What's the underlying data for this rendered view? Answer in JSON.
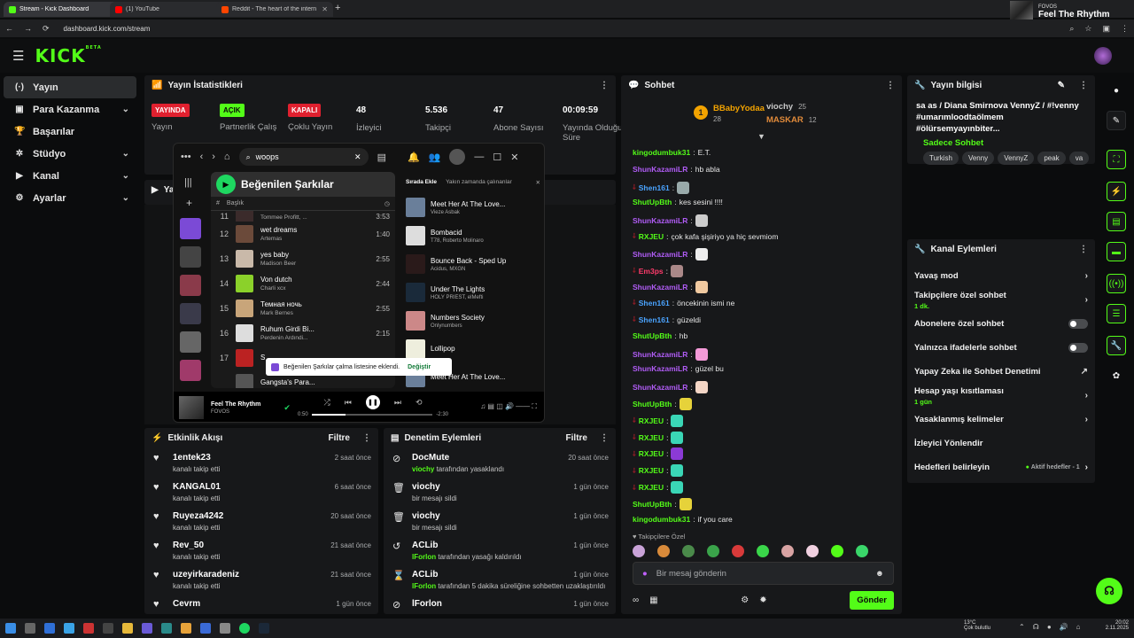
{
  "browser": {
    "tabs": [
      {
        "label": "Stream - Kick Dashboard",
        "color": "#53fc18"
      },
      {
        "label": "(1) YouTube",
        "color": "#ff0000"
      },
      {
        "label": "Reddit - The heart of the intern",
        "color": "#ff4500"
      }
    ],
    "url": "dashboard.kick.com/stream",
    "profile": {
      "channel": "FOVOS",
      "title": "Feel The Rhythm"
    }
  },
  "kick": {
    "logo": "KICK",
    "beta": "BETA"
  },
  "sidebar": {
    "items": [
      {
        "label": "Yayın",
        "icon": "broadcast-icon",
        "selected": true,
        "chevron": false
      },
      {
        "label": "Para Kazanma",
        "icon": "wallet-icon",
        "selected": false,
        "chevron": true
      },
      {
        "label": "Başarılar",
        "icon": "trophy-icon",
        "selected": false,
        "chevron": false
      },
      {
        "label": "Stüdyo",
        "icon": "gear-icon",
        "selected": false,
        "chevron": true
      },
      {
        "label": "Kanal",
        "icon": "play-icon",
        "selected": false,
        "chevron": true
      },
      {
        "label": "Ayarlar",
        "icon": "settings-icon",
        "selected": false,
        "chevron": true
      }
    ]
  },
  "stats": {
    "title": "Yayın İstatistikleri",
    "items": [
      {
        "badge": "YAYINDA",
        "label": "Yayın"
      },
      {
        "badge": "AÇIK",
        "label": "Partnerlik Çalış"
      },
      {
        "badge": "KAPALI",
        "label": "Çoklu Yayın"
      },
      {
        "value": "48",
        "label": "İzleyici"
      },
      {
        "value": "5.536",
        "label": "Takipçi"
      },
      {
        "value": "47",
        "label": "Abone Sayısı"
      },
      {
        "value": "00:09:59",
        "label": "Yayında Olduğu Süre"
      }
    ]
  },
  "spotify": {
    "search": "woops",
    "playlist": "Beğenilen Şarkılar",
    "header_title": "Başlık",
    "tracks": [
      {
        "n": "11",
        "title": "",
        "artist": "Tommee Profitt, ...",
        "dur": "3:53",
        "color": "#3b2b2b"
      },
      {
        "n": "12",
        "title": "wet dreams",
        "artist": "Artemas",
        "dur": "1:40",
        "color": "#6b4a3a"
      },
      {
        "n": "13",
        "title": "yes baby",
        "artist": "Madison Beer",
        "dur": "2:55",
        "color": "#c9b9a9"
      },
      {
        "n": "14",
        "title": "Von dutch",
        "artist": "Charli xcx",
        "dur": "2:44",
        "color": "#8bd12a"
      },
      {
        "n": "15",
        "title": "Темная ночь",
        "artist": "Mark Bernes",
        "dur": "2:55",
        "color": "#c8a57a"
      },
      {
        "n": "16",
        "title": "Ruhum Girdi Bi...",
        "artist": "Perdenin Ardındi...",
        "dur": "2:15",
        "color": "#ddd"
      },
      {
        "n": "17",
        "title": "S",
        "artist": "",
        "dur": "",
        "color": "#b22"
      },
      {
        "n": "",
        "title": "Gangsta's Para...",
        "artist": "",
        "dur": "",
        "color": "#555"
      }
    ],
    "queue_tabs": [
      "Sırada Ekle",
      "Yakın zamanda çalınanlar"
    ],
    "queue": [
      {
        "title": "Meet Her At The Love...",
        "artist": "Vieze Asbak",
        "color": "#6a7f9a"
      },
      {
        "title": "Bombacid",
        "artist": "T78, Roberto Molinaro",
        "color": "#ddd"
      },
      {
        "title": "Bounce Back - Sped Up",
        "artist": "Acidus, MXGN",
        "color": "#2a1a1a"
      },
      {
        "title": "Under The Lights",
        "artist": "HOLY PRIEST, elMefti",
        "color": "#1a2a3a"
      },
      {
        "title": "Numbers Society",
        "artist": "Onlynumbers",
        "color": "#c88"
      },
      {
        "title": "Lollipop",
        "artist": "",
        "color": "#eed"
      },
      {
        "title": "Meet Her At The Love...",
        "artist": "",
        "color": "#6a7f9a"
      }
    ],
    "toast": "Beğenilen Şarkılar çalma listesine eklendi.",
    "toast_action": "Değiştir",
    "now_playing": {
      "title": "Feel The Rhythm",
      "artist": "FOVOS",
      "elapsed": "0:50",
      "remaining": "-2:30",
      "progress": 0.28
    }
  },
  "activity": {
    "title": "Etkinlik Akışı",
    "filter": "Filtre",
    "events": [
      {
        "name": "1entek23",
        "desc": "kanalı takip etti",
        "time": "2 saat önce"
      },
      {
        "name": "KANGAL01",
        "desc": "kanalı takip etti",
        "time": "6 saat önce"
      },
      {
        "name": "Ruyeza4242",
        "desc": "kanalı takip etti",
        "time": "20 saat önce"
      },
      {
        "name": "Rev_50",
        "desc": "kanalı takip etti",
        "time": "21 saat önce"
      },
      {
        "name": "uzeyirkaradeniz",
        "desc": "kanalı takip etti",
        "time": "21 saat önce"
      },
      {
        "name": "Cevrm",
        "desc": "",
        "time": "1 gün önce"
      }
    ]
  },
  "moderation": {
    "title": "Denetim Eylemleri",
    "filter": "Filtre",
    "events": [
      {
        "name": "DocMute",
        "actor": "viochy",
        "desc": "tarafından yasaklandı",
        "time": "20 saat önce",
        "icon": "ban-icon"
      },
      {
        "name": "viochy",
        "actor": "",
        "desc": "bir mesajı sildi",
        "time": "1 gün önce",
        "icon": "trash-icon"
      },
      {
        "name": "viochy",
        "actor": "",
        "desc": "bir mesajı sildi",
        "time": "1 gün önce",
        "icon": "trash-icon"
      },
      {
        "name": "ACLib",
        "actor": "lForlon",
        "desc": "tarafından yasağı kaldırıldı",
        "time": "1 gün önce",
        "icon": "undo-icon"
      },
      {
        "name": "ACLib",
        "actor": "lForlon",
        "desc": "tarafından 5 dakika süreliğine sohbetten uzaklaştırıldı",
        "time": "1 gün önce",
        "icon": "hourglass-icon"
      },
      {
        "name": "lForlon",
        "actor": "",
        "desc": "",
        "time": "1 gün önce",
        "icon": "ban-icon"
      }
    ]
  },
  "chat": {
    "title": "Sohbet",
    "pinned": [
      {
        "name": "BBabyYodaa",
        "count": "28",
        "color": "#f3a300"
      },
      {
        "name": "viochy",
        "count": "25",
        "color": "#c9c9c9"
      },
      {
        "name": "MASKAR",
        "count": "12",
        "color": "#e08a3a"
      }
    ],
    "messages": [
      {
        "user": "kingodumbuk31",
        "color": "#53fc18",
        "text": "E.T.",
        "badge": false,
        "emote": ""
      },
      {
        "user": "ShunKazamiLR",
        "color": "#b05cf5",
        "text": "hb abla",
        "badge": false,
        "emote": ""
      },
      {
        "user": "Shen161",
        "color": "#4aa3ff",
        "text": "",
        "badge": true,
        "emote": "#9aa"
      },
      {
        "user": "ShutUpBth",
        "color": "#53fc18",
        "text": "kes sesini !!!!",
        "badge": false,
        "emote": ""
      },
      {
        "user": "ShunKazamiLR",
        "color": "#b05cf5",
        "text": "",
        "badge": false,
        "emote": "#ccc"
      },
      {
        "user": "RXJEU",
        "color": "#53fc18",
        "text": "çok kafa şişiriyo ya hiç sevmiom",
        "badge": true,
        "emote": ""
      },
      {
        "user": "ShunKazamiLR",
        "color": "#b05cf5",
        "text": "",
        "badge": false,
        "emote": "#eee"
      },
      {
        "user": "Em3ps",
        "color": "#ff3b6b",
        "text": "",
        "badge": true,
        "emote": "#a88"
      },
      {
        "user": "ShunKazamiLR",
        "color": "#b05cf5",
        "text": "",
        "badge": false,
        "emote": "#f0c9a0"
      },
      {
        "user": "Shen161",
        "color": "#4aa3ff",
        "text": "öncekinin ismi ne",
        "badge": true,
        "emote": ""
      },
      {
        "user": "Shen161",
        "color": "#4aa3ff",
        "text": "güzeldi",
        "badge": true,
        "emote": ""
      },
      {
        "user": "ShutUpBth",
        "color": "#53fc18",
        "text": "hb",
        "badge": false,
        "emote": ""
      },
      {
        "user": "ShunKazamiLR",
        "color": "#b05cf5",
        "text": "",
        "badge": false,
        "emote": "#f49ad8"
      },
      {
        "user": "ShunKazamiLR",
        "color": "#b05cf5",
        "text": "güzel bu",
        "badge": false,
        "emote": ""
      },
      {
        "user": "ShunKazamiLR",
        "color": "#b05cf5",
        "text": "",
        "badge": false,
        "emote": "#f4d6c6"
      },
      {
        "user": "ShutUpBth",
        "color": "#53fc18",
        "text": "",
        "badge": false,
        "emote": "#e6d23a"
      },
      {
        "user": "RXJEU",
        "color": "#53fc18",
        "text": "",
        "badge": true,
        "emote": "#3ad6b6"
      },
      {
        "user": "RXJEU",
        "color": "#53fc18",
        "text": "",
        "badge": true,
        "emote": "#3ad6b6"
      },
      {
        "user": "RXJEU",
        "color": "#53fc18",
        "text": "",
        "badge": true,
        "emote": "#8b3ad6"
      },
      {
        "user": "RXJEU",
        "color": "#53fc18",
        "text": "",
        "badge": true,
        "emote": "#3ad6b6"
      },
      {
        "user": "RXJEU",
        "color": "#53fc18",
        "text": "",
        "badge": true,
        "emote": "#3ad6b6"
      },
      {
        "user": "ShutUpBth",
        "color": "#53fc18",
        "text": "",
        "badge": false,
        "emote": "#e6d23a"
      },
      {
        "user": "kingodumbuk31",
        "color": "#53fc18",
        "text": "if you care",
        "badge": false,
        "emote": ""
      }
    ],
    "followers_label": "Takipçilere Özel",
    "emotes": [
      "#c9a3d8",
      "#d88a3a",
      "#4a8a4a",
      "#3aa34a",
      "#d83a3a",
      "#3ad64a",
      "#d8a3a3",
      "#f0d0e0",
      "#53fc18",
      "#3ad66a"
    ],
    "placeholder": "Bir mesaj gönderin",
    "send": "Gönder"
  },
  "stream_info": {
    "header": "Yayın bilgisi",
    "title": "sa as / Diana Smirnova VennyZ / #!venny #umarımloodtaölmem #ölürsemyayınbiter...",
    "category": "Sadece Sohbet",
    "tags": [
      "Turkish",
      "Venny",
      "VennyZ",
      "peak",
      "va"
    ]
  },
  "channel_actions": {
    "header": "Kanal Eylemleri",
    "items": [
      {
        "label": "Yavaş mod",
        "sub": "",
        "kind": "chevron"
      },
      {
        "label": "Takipçilere özel sohbet",
        "sub": "1 dk.",
        "kind": "chevron"
      },
      {
        "label": "Abonelere özel sohbet",
        "sub": "",
        "kind": "toggle"
      },
      {
        "label": "Yalnızca ifadelerle sohbet",
        "sub": "",
        "kind": "toggle"
      },
      {
        "label": "Yapay Zeka ile Sohbet Denetimi",
        "sub": "",
        "kind": "external"
      },
      {
        "label": "Hesap yaşı kısıtlaması",
        "sub": "1 gün",
        "kind": "chevron"
      },
      {
        "label": "Yasaklanmış kelimeler",
        "sub": "",
        "kind": "chevron"
      },
      {
        "label": "İzleyici Yönlendir",
        "sub": "",
        "kind": "none"
      },
      {
        "label": "Hedefleri belirleyin",
        "sub": "",
        "kind": "goal",
        "hint": "Aktif hedefler - 1"
      }
    ]
  },
  "taskbar": {
    "weather_temp": "13°C",
    "weather_desc": "Çok bulutlu",
    "time": "20:02",
    "date": "2.11.2025"
  }
}
